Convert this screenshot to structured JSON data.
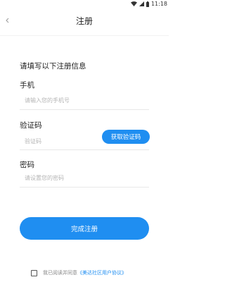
{
  "status_bar": {
    "time": "11:18",
    "icons": [
      "wifi-icon",
      "signal-icon",
      "battery-icon"
    ]
  },
  "header": {
    "back_icon": "chevron-left-icon",
    "title": "注册"
  },
  "form": {
    "heading": "请填写以下注册信息",
    "phone": {
      "label": "手机",
      "placeholder": "请输入您的手机号",
      "value": ""
    },
    "code": {
      "label": "验证码",
      "placeholder": "验证码",
      "value": "",
      "button_label": "获取验证码"
    },
    "password": {
      "label": "密码",
      "placeholder": "请设置您的密码",
      "value": ""
    },
    "submit_label": "完成注册"
  },
  "agreement": {
    "checked": false,
    "text": "我已阅读并同意",
    "link": "《美达社区用户协议》"
  },
  "colors": {
    "accent": "#1f8ef1",
    "placeholder": "#b5b5b5",
    "divider": "#e8e8e8"
  }
}
